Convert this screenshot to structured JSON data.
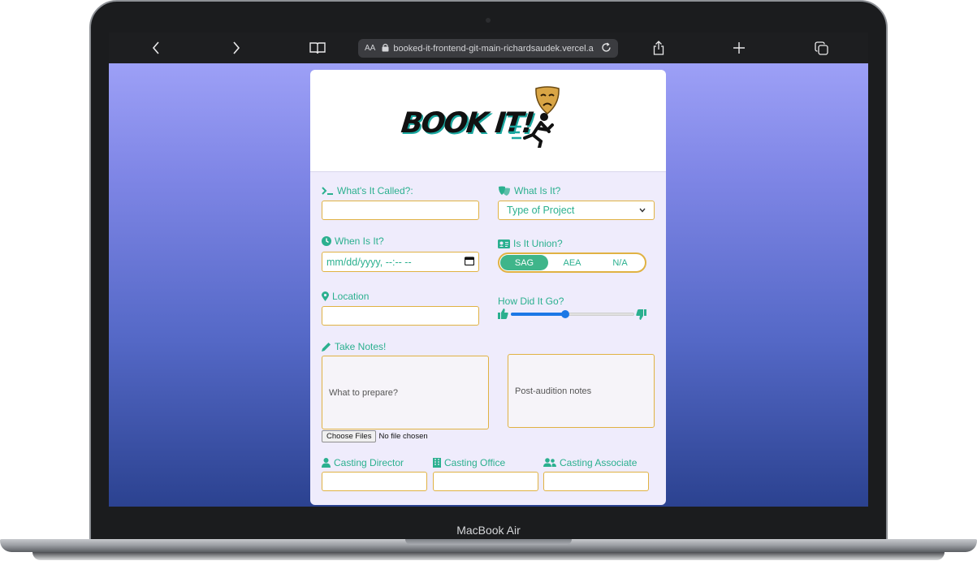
{
  "device": {
    "model_label": "MacBook Air"
  },
  "browser": {
    "aa_label": "AA",
    "url": "booked-it-frontend-git-main-richardsaudek.vercel.a"
  },
  "app": {
    "logo_text": "BOOK IT!",
    "fields": {
      "title_label": "What's It Called?:",
      "type_label": "What Is It?",
      "type_selected": "Type of Project",
      "date_label": "When Is It?",
      "date_value": "mm/dd/yyyy, --:-- --",
      "union_label": "Is It Union?",
      "union_options": [
        "SAG",
        "AEA",
        "N/A"
      ],
      "union_selected": "SAG",
      "location_label": "Location",
      "rating_label": "How Did It Go?",
      "rating_value": 0.44,
      "notes_label": "Take Notes!",
      "prepare_placeholder": "What to prepare?",
      "post_placeholder": "Post-audition notes",
      "file_button": "Choose Files",
      "file_status": "No file chosen",
      "director_label": "Casting Director",
      "office_label": "Casting Office",
      "associate_label": "Casting Associate"
    }
  },
  "colors": {
    "accent": "#2bb08f",
    "border": "#e0b243",
    "slider": "#1c78e6"
  }
}
